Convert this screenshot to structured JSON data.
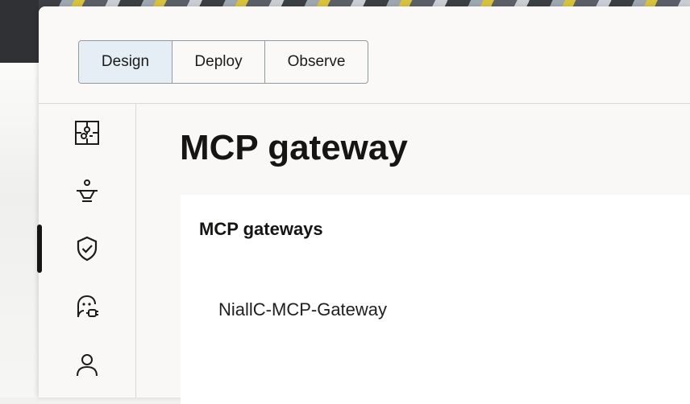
{
  "tabs": [
    {
      "label": "Design",
      "active": true
    },
    {
      "label": "Deploy",
      "active": false
    },
    {
      "label": "Observe",
      "active": false
    }
  ],
  "nav_rail": [
    {
      "icon": "puzzle-icon",
      "active": false
    },
    {
      "icon": "service-bell-icon",
      "active": false
    },
    {
      "icon": "shield-check-icon",
      "active": true
    },
    {
      "icon": "agent-plug-icon",
      "active": false
    },
    {
      "icon": "user-icon",
      "active": false
    }
  ],
  "page": {
    "title": "MCP gateway"
  },
  "gateways_card": {
    "title": "MCP gateways",
    "items": [
      "NiallC-MCP-Gateway"
    ]
  },
  "colors": {
    "active_tab_bg": "#e5eef4",
    "border": "#8f9aa3",
    "text": "#161513",
    "active_indicator": "#161513"
  }
}
